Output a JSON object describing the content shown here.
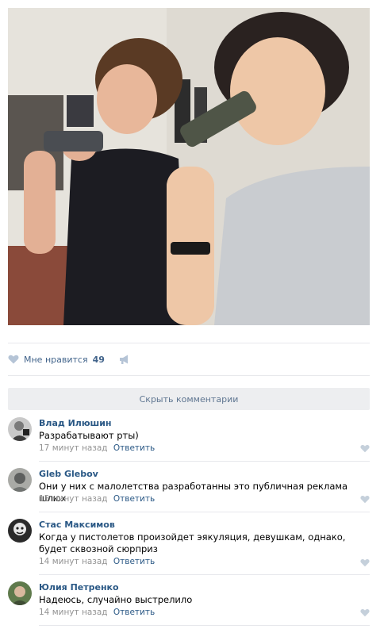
{
  "post": {
    "likes": {
      "label": "Мне нравится",
      "count": "49"
    },
    "hide_comments": "Скрыть комментарии"
  },
  "colors": {
    "link": "#2a5885",
    "meta": "#939393",
    "bar": "#edeef0"
  },
  "comments": [
    {
      "author": "Влад Илюшин",
      "text": "Разрабатывают рты)",
      "time": "17 минут назад",
      "reply": "Ответить"
    },
    {
      "author": "Gleb Glebov",
      "text": "Они у них с малолетства разработанны это публичная реклама шлюх",
      "time": "15 минут назад",
      "reply": "Ответить"
    },
    {
      "author": "Стас Максимов",
      "text": "Когда у пистолетов произойдет эякуляция, девушкам, однако, будет сквозной сюрприз",
      "time": "14 минут назад",
      "reply": "Ответить"
    },
    {
      "author": "Юлия Петренко",
      "text": "Надеюсь, случайно выстрелило",
      "time": "14 минут назад",
      "reply": "Ответить"
    }
  ]
}
